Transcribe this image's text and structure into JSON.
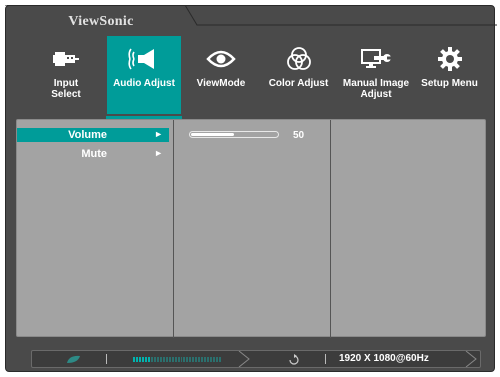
{
  "brand": "ViewSonic",
  "tabs": [
    {
      "label": "Input Select",
      "icon": "input-select-icon"
    },
    {
      "label": "Audio Adjust",
      "icon": "speaker-icon",
      "active": true
    },
    {
      "label": "ViewMode",
      "icon": "eye-icon"
    },
    {
      "label": "Color Adjust",
      "icon": "color-circles-icon"
    },
    {
      "label": "Manual Image Adjust",
      "icon": "monitor-wrench-icon"
    },
    {
      "label": "Setup Menu",
      "icon": "gear-icon"
    }
  ],
  "menu": [
    {
      "label": "Volume",
      "arrow": "►",
      "selected": true
    },
    {
      "label": "Mute",
      "arrow": "►",
      "selected": false
    }
  ],
  "volume": {
    "value": "50",
    "level": 0.5
  },
  "status": {
    "resolution": "1920 X 1080@60Hz",
    "battery_level": 0.2
  },
  "colors": {
    "accent": "#009c99",
    "frame": "#4a4a4a",
    "panel": "#a3a3a3"
  }
}
